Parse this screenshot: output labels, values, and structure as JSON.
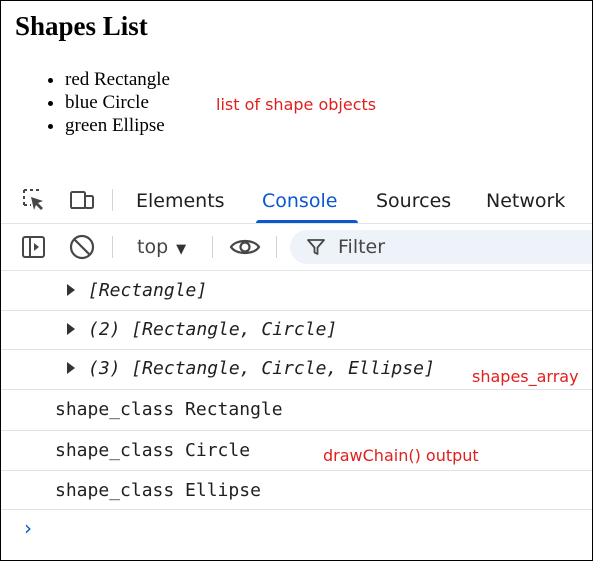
{
  "page": {
    "title": "Shapes List",
    "items": [
      "red Rectangle",
      "blue Circle",
      "green Ellipse"
    ]
  },
  "annotations": {
    "list_note": "list of shape objects",
    "array_note": "shapes_array",
    "chain_note": "drawChain() output",
    "color": "#e0201c"
  },
  "devtools": {
    "toolbar_icons": [
      "inspect-element-icon",
      "device-toolbar-icon"
    ],
    "tabs": [
      {
        "label": "Elements",
        "active": false
      },
      {
        "label": "Console",
        "active": true
      },
      {
        "label": "Sources",
        "active": false
      },
      {
        "label": "Network",
        "active": false
      }
    ],
    "console_toolbar": {
      "context": "top",
      "filter_placeholder": "Filter"
    },
    "accent_color": "#0b57d0"
  },
  "console_lines": [
    {
      "kind": "array",
      "text": "[Rectangle]"
    },
    {
      "kind": "array",
      "text": "(2) [Rectangle, Circle]"
    },
    {
      "kind": "array",
      "text": "(3) [Rectangle, Circle, Ellipse]"
    },
    {
      "kind": "log",
      "text": "shape_class Rectangle"
    },
    {
      "kind": "log",
      "text": "shape_class Circle"
    },
    {
      "kind": "log",
      "text": "shape_class Ellipse"
    }
  ],
  "prompt_symbol": "›"
}
